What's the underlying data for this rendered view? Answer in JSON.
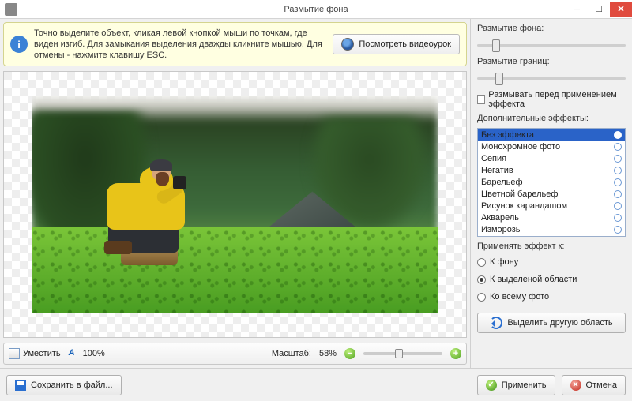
{
  "window": {
    "title": "Размытие фона"
  },
  "hint": {
    "text": "Точно выделите объект, кликая левой кнопкой мыши по точкам, где виден изгиб. Для замыкания выделения дважды кликните мышью. Для отмены - нажмите клавишу ESC.",
    "video_button": "Посмотреть видеоурок"
  },
  "toolbar": {
    "fit": "Уместить",
    "hundred": "100%",
    "scale_label": "Масштаб:",
    "scale_value": "58%"
  },
  "panel": {
    "blur_bg_label": "Размытие фона:",
    "blur_edge_label": "Размытие границ:",
    "pre_blur_checkbox": "Размывать перед применением эффекта",
    "effects_label": "Дополнительные эффекты:",
    "effects": [
      "Без эффекта",
      "Монохромное фото",
      "Сепия",
      "Негатив",
      "Барельеф",
      "Цветной барельеф",
      "Рисунок карандашом",
      "Акварель",
      "Изморозь"
    ],
    "apply_to_label": "Применять эффект к:",
    "apply_to": {
      "bg": "К фону",
      "sel": "К выделеной области",
      "all": "Ко всему фото"
    },
    "reselect_button": "Выделить другую область"
  },
  "footer": {
    "save": "Сохранить в файл...",
    "apply": "Применить",
    "cancel": "Отмена"
  }
}
